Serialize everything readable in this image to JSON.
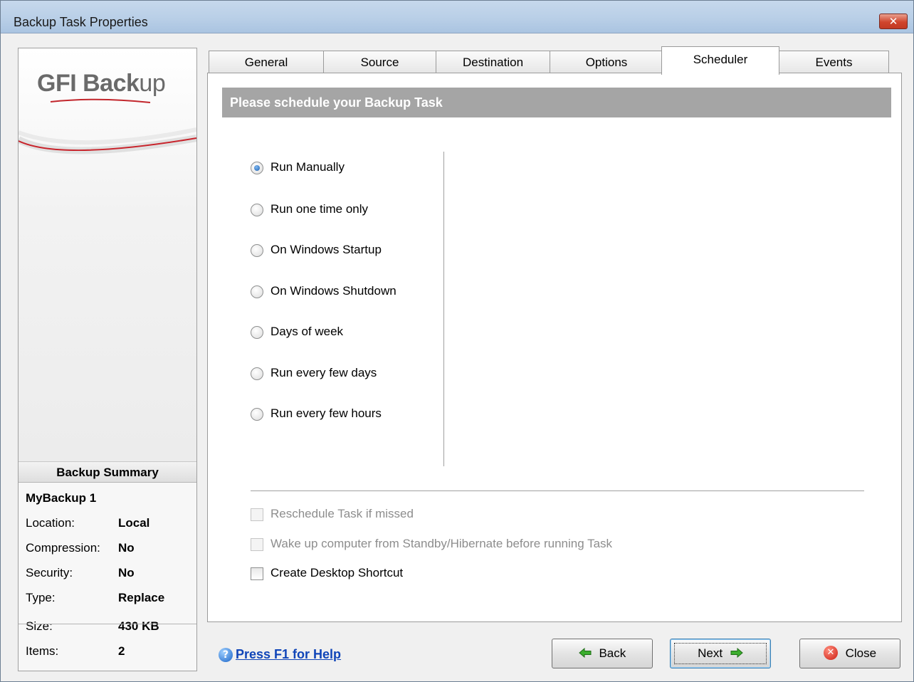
{
  "window": {
    "title": "Backup Task Properties",
    "close_glyph": "✕"
  },
  "brand": {
    "logo_gfi": "GFI",
    "logo_back": "Back",
    "logo_up": "up",
    "logo_red": "#d0202a"
  },
  "summary": {
    "header": "Backup Summary",
    "name": "MyBackup 1",
    "location_label": "Location:",
    "location_value": "Local",
    "compression_label": "Compression:",
    "compression_value": "No",
    "security_label": "Security:",
    "security_value": "No",
    "type_label": "Type:",
    "type_value": "Replace",
    "size_label": "Size:",
    "size_value": "430 KB",
    "items_label": "Items:",
    "items_value": "2"
  },
  "tabs": [
    {
      "label": "General"
    },
    {
      "label": "Source"
    },
    {
      "label": "Destination"
    },
    {
      "label": "Options"
    },
    {
      "label": "Scheduler",
      "active": true
    },
    {
      "label": "Events"
    }
  ],
  "scheduler": {
    "banner": "Please schedule your Backup Task",
    "options": [
      {
        "label": "Run Manually",
        "checked": true
      },
      {
        "label": "Run one time only",
        "checked": false
      },
      {
        "label": "On Windows Startup",
        "checked": false
      },
      {
        "label": "On Windows Shutdown",
        "checked": false
      },
      {
        "label": "Days of week",
        "checked": false
      },
      {
        "label": "Run every few days",
        "checked": false
      },
      {
        "label": "Run every few hours",
        "checked": false
      }
    ],
    "checks": [
      {
        "label": "Reschedule Task if missed",
        "checked": false,
        "disabled": true
      },
      {
        "label": "Wake up computer from Standby/Hibernate before running Task",
        "checked": false,
        "disabled": true
      },
      {
        "label": "Create Desktop Shortcut",
        "checked": false,
        "disabled": false
      }
    ]
  },
  "footer": {
    "help_icon_glyph": "?",
    "help_text": "Press F1 for Help",
    "back_label": "Back",
    "next_label": "Next",
    "close_label": "Close",
    "close_icon_glyph": "✕",
    "arrow_color": "#3cae2e"
  },
  "icons": {
    "help": "help-icon",
    "back": "back-arrow-icon",
    "next": "next-arrow-icon",
    "close": "close-circle-icon"
  }
}
